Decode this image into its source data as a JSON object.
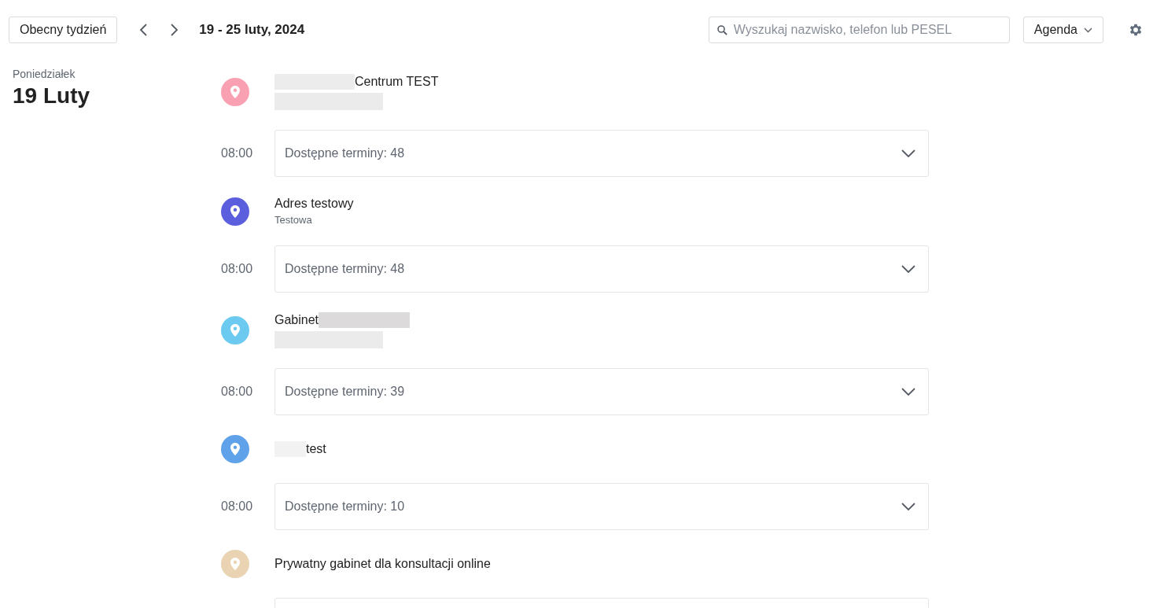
{
  "toolbar": {
    "current_week_button": "Obecny tydzień",
    "date_range": "19 - 25 luty, 2024",
    "search": {
      "placeholder": "Wyszukaj nazwisko, telefon lub PESEL"
    },
    "view_select": "Agenda"
  },
  "day": {
    "weekday": "Poniedziałek",
    "date": "19 Luty"
  },
  "locations": [
    {
      "name": "Centrum TEST",
      "color": "#f9a0b2",
      "redacted_before": true,
      "detail_redacted": true,
      "slots": [
        {
          "time": "08:00",
          "summary": "Dostępne terminy: 48"
        }
      ]
    },
    {
      "name": "Adres testowy",
      "color": "#5b5fde",
      "detail": "Testowa",
      "slots": [
        {
          "time": "08:00",
          "summary": "Dostępne terminy: 48"
        }
      ]
    },
    {
      "name": "Gabinet",
      "color": "#6ccaf0",
      "redacted_after": true,
      "detail_redacted": true,
      "slots": [
        {
          "time": "08:00",
          "summary": "Dostępne terminy: 39"
        }
      ]
    },
    {
      "name": "test",
      "color": "#5fa2ea",
      "redacted_before": true,
      "slots": [
        {
          "time": "08:00",
          "summary": "Dostępne terminy: 10"
        }
      ]
    },
    {
      "name": "Prywatny gabinet dla konsultacji online",
      "color": "#e9d3b2",
      "card_below": true
    }
  ]
}
